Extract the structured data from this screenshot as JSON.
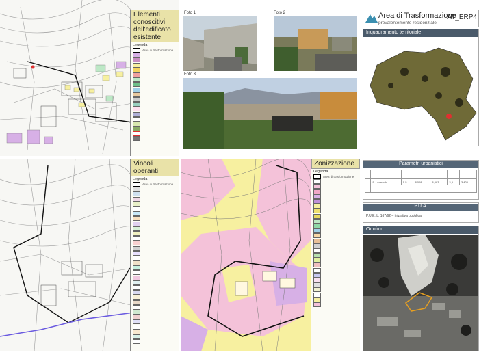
{
  "header": {
    "title": "Area di Trasformazione",
    "subtitle": "prevalentemente residenziale",
    "code": "AT_ERP4"
  },
  "panels": {
    "existing_elements": {
      "title": "Elementi conoscitivi dell'edificato esistente",
      "legend_label": "Legenda",
      "first_item": "Area di trasformazione"
    },
    "constraints": {
      "title": "Vincoli operanti",
      "legend_label": "Legenda",
      "first_item": "Area di trasformazione"
    },
    "zoning": {
      "title": "Zonizzazione",
      "legend_label": "Legenda",
      "first_item": "Area di trasformazione"
    }
  },
  "photos": {
    "foto1": "Foto 1",
    "foto2": "Foto 2",
    "foto3": "Foto 3"
  },
  "territorial": {
    "title": "Inquadramento territoriale"
  },
  "parameters": {
    "title": "Parametri urbanistici",
    "row_name": "S. Leonardo",
    "row_values": [
      "5.5",
      "8,008",
      "8,093",
      "2,5",
      "3,420"
    ]
  },
  "pua": {
    "title": "P.U.A.",
    "note": "P.U.E. L. 167/62 – iniziativa pubblica"
  },
  "orthophoto": {
    "title": "Ortofoto"
  },
  "colors": {
    "pink_zone": "#f4c2d9",
    "yellow_zone": "#f7f0a0",
    "purple_zone": "#d7b0e6",
    "legend_head": "#e9e2a8",
    "title_bar": "#4a5a6a",
    "map_land": "#6f6a37",
    "sea": "#ffffff"
  }
}
